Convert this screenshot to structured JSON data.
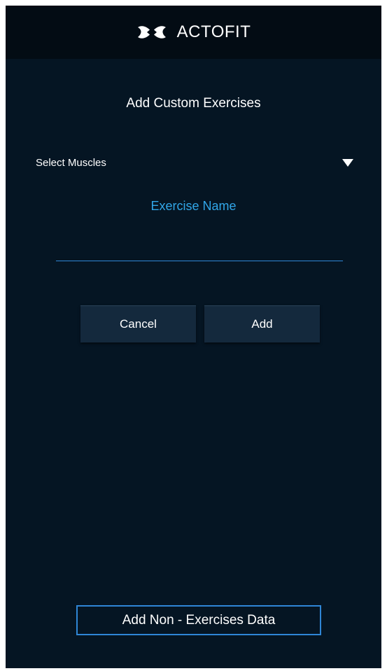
{
  "header": {
    "brand_name": "ACTOFIT",
    "logo_icon": "actofit-logo-icon"
  },
  "page": {
    "title": "Add Custom Exercises"
  },
  "muscle_select": {
    "label": "Select Muscles",
    "icon": "dropdown-triangle-icon"
  },
  "exercise_name": {
    "label": "Exercise Name",
    "value": ""
  },
  "buttons": {
    "cancel_label": "Cancel",
    "add_label": "Add",
    "non_exercise_label": "Add Non - Exercises Data"
  },
  "colors": {
    "background": "#051523",
    "header_background": "#030c14",
    "accent": "#31a6e8",
    "input_underline": "#2f86d6",
    "button_background": "#14293d"
  }
}
